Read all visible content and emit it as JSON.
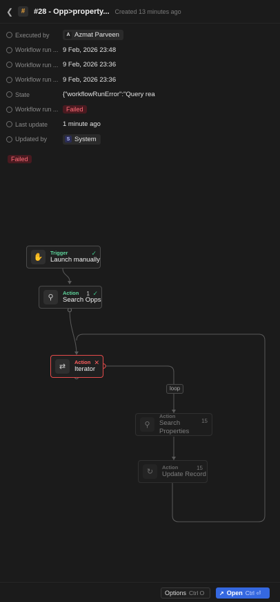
{
  "header": {
    "back_icon": "chevron-left-icon",
    "run_icon": "#",
    "title": "#28 - Opp>property...",
    "created": "Created 13 minutes ago"
  },
  "fields": [
    {
      "icon": "user-circle-icon",
      "label": "Executed by",
      "value": "Azmat Parveen",
      "avatar": "A"
    },
    {
      "icon": "history-icon",
      "label": "Workflow run ...",
      "value": "9 Feb, 2026 23:48"
    },
    {
      "icon": "history-icon",
      "label": "Workflow run ...",
      "value": "9 Feb, 2026 23:36"
    },
    {
      "icon": "history-icon",
      "label": "Workflow run ...",
      "value": "9 Feb, 2026 23:36"
    },
    {
      "icon": "branch-icon",
      "label": "State",
      "value": "{\"workflowRunError\":\"Query rea"
    },
    {
      "icon": "status-icon",
      "label": "Workflow run ...",
      "value": "Failed"
    },
    {
      "icon": "calendar-icon",
      "label": "Last update",
      "value": "1 minute ago"
    },
    {
      "icon": "user-circle-icon",
      "label": "Updated by",
      "value": "System",
      "avatar": "S"
    }
  ],
  "status_badge": "Failed",
  "workflow": {
    "nodes": [
      {
        "kind": "Trigger",
        "name": "Launch manually",
        "icon": "hand-icon",
        "status": "success"
      },
      {
        "kind": "Action",
        "name": "Search Opps",
        "icon": "search-icon",
        "count": "1",
        "status": "success"
      },
      {
        "kind": "Action",
        "name": "Iterator",
        "icon": "repeat-icon",
        "status": "error"
      },
      {
        "kind": "Action",
        "name": "Search Properties",
        "icon": "search-icon",
        "count": "15"
      },
      {
        "kind": "Action",
        "name": "Update Record",
        "icon": "refresh-icon",
        "count": "15"
      }
    ],
    "loop_label": "loop"
  },
  "footer": {
    "options_label": "Options",
    "options_shortcut": "Ctrl O",
    "open_label": "Open",
    "open_shortcut": "Ctrl ⏎"
  },
  "colors": {
    "background": "#1b1b1b",
    "success": "#5ed49c",
    "error": "#ff6060",
    "accent": "#3568e0"
  }
}
